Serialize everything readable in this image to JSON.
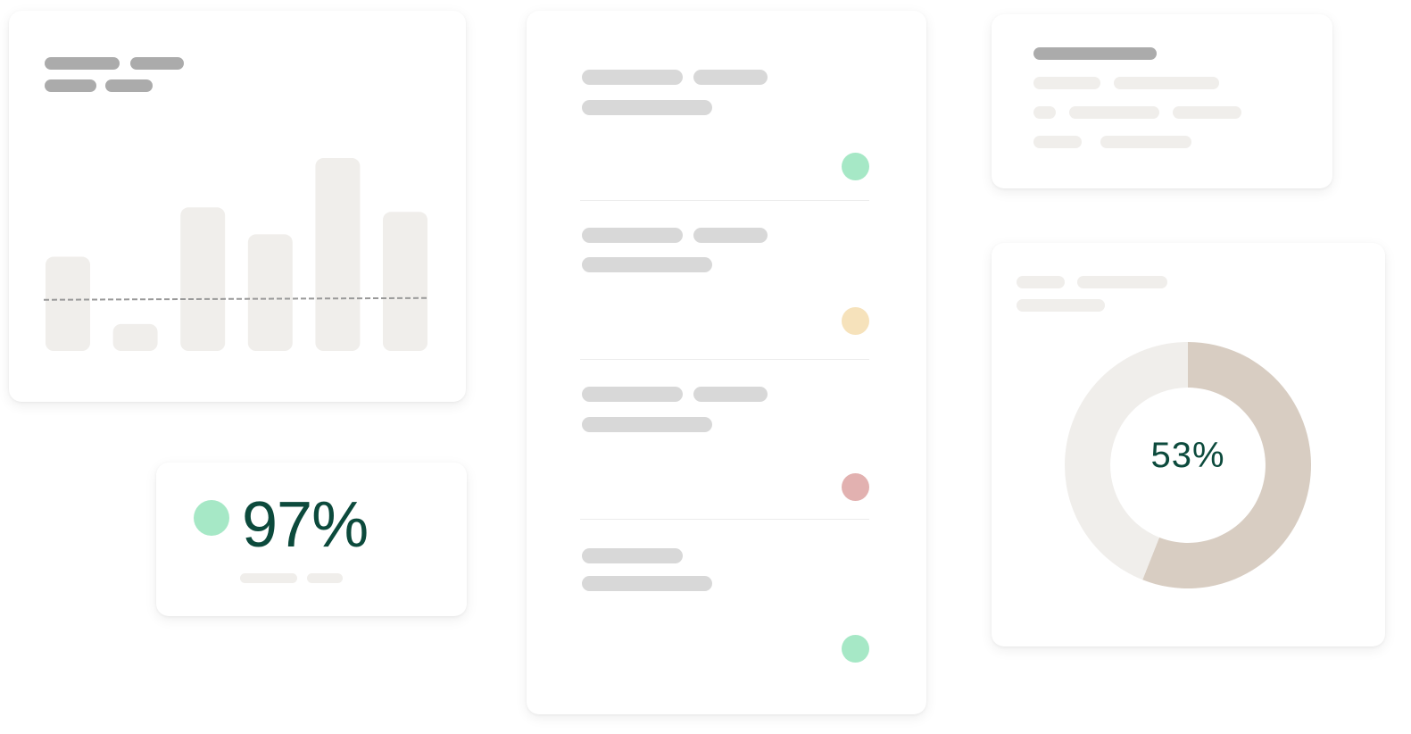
{
  "colors": {
    "accent_text": "#0c4a3c",
    "status_green": "#a6e8c6",
    "status_yellow": "#f6e2bb",
    "status_red": "#e2b1b0",
    "bar_fill": "#f0eeeb",
    "donut_track": "#f0eeeb",
    "donut_fill": "#d8cdc2",
    "baseline": "#999999"
  },
  "bar_card": {
    "chart_data": {
      "type": "bar",
      "values": [
        21,
        6,
        32,
        26,
        43,
        31
      ],
      "reference_line": 11.6,
      "ylim": [
        0,
        44
      ]
    }
  },
  "stat_card": {
    "value": "97%",
    "status": "green"
  },
  "list_card": {
    "items": [
      {
        "status": "green"
      },
      {
        "status": "yellow"
      },
      {
        "status": "red"
      },
      {
        "status": "green"
      }
    ]
  },
  "donut_card": {
    "label": "53%",
    "chart_data": {
      "type": "pie",
      "values": [
        56,
        44
      ],
      "inner_radius_ratio": 0.63
    }
  }
}
